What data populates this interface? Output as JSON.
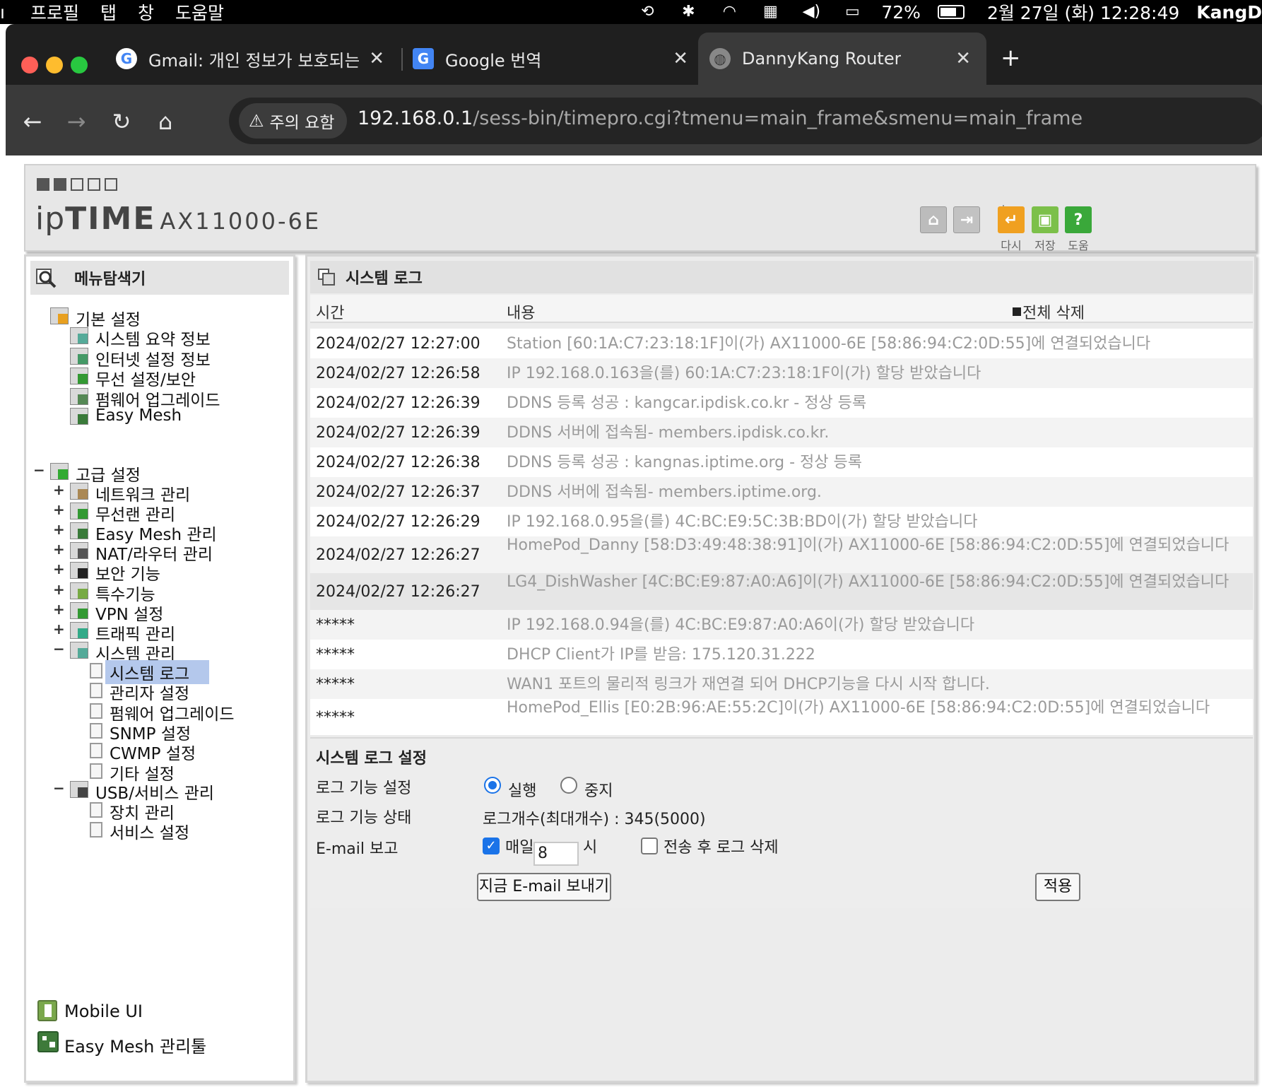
{
  "menubar": {
    "apple_partial": "ı",
    "items": [
      "프로필",
      "탭",
      "창",
      "도움말"
    ],
    "battery": "72%",
    "datetime": "2월 27일 (화)  12:28:49",
    "user": "KangD"
  },
  "browser": {
    "tabs": [
      {
        "title": "Gmail: 개인 정보가 보호되는 안전한",
        "favicon": "google-g"
      },
      {
        "title": "Google 번역",
        "favicon": "google-translate"
      },
      {
        "title": "DannyKang Router",
        "favicon": "globe",
        "active": true
      }
    ],
    "security_label": "주의 요함",
    "url_host": "192.168.0.1",
    "url_path": "/sess-bin/timepro.cgi?tmenu=main_frame&smenu=main_frame"
  },
  "header": {
    "brand_ip": "ip",
    "brand_time": "TIME",
    "model": "AX11000-6E",
    "buttons": [
      {
        "icon": "home-icon",
        "label": ""
      },
      {
        "icon": "logout-icon",
        "label": ""
      },
      {
        "icon": "restart-icon",
        "label": "다시",
        "color": "#f0a020"
      },
      {
        "icon": "save-icon",
        "label": "저장",
        "color": "#7cc04a"
      },
      {
        "icon": "help-icon",
        "label": "도움",
        "color": "#3aa83a"
      }
    ]
  },
  "sidebar": {
    "title": "메뉴탐색기",
    "basic": {
      "label": "기본 설정",
      "items": [
        "시스템 요약 정보",
        "인터넷 설정 정보",
        "무선 설정/보안",
        "펌웨어 업그레이드",
        "Easy Mesh"
      ]
    },
    "advanced": {
      "label": "고급 설정",
      "items": [
        "네트워크 관리",
        "무선랜 관리",
        "Easy Mesh 관리",
        "NAT/라우터 관리",
        "보안 기능",
        "특수기능",
        "VPN 설정",
        "트래픽 관리"
      ],
      "system": {
        "label": "시스템 관리",
        "items": [
          "시스템 로그",
          "관리자 설정",
          "펌웨어 업그레이드",
          "SNMP 설정",
          "CWMP 설정",
          "기타 설정"
        ]
      },
      "usb": {
        "label": "USB/서비스 관리",
        "items": [
          "장치 관리",
          "서비스 설정"
        ]
      }
    },
    "footer": [
      "Mobile UI",
      "Easy Mesh 관리툴"
    ]
  },
  "main": {
    "title": "시스템 로그",
    "col_time": "시간",
    "col_content": "내용",
    "delete_all": "전체 삭제",
    "logs": [
      {
        "time": "2024/02/27 12:27:00",
        "msg": "Station [60:1A:C7:23:18:1F]이(가) AX11000-6E [58:86:94:C2:0D:55]에 연결되었습니다"
      },
      {
        "time": "2024/02/27 12:26:58",
        "msg": "IP 192.168.0.163을(를) 60:1A:C7:23:18:1F이(가) 할당 받았습니다"
      },
      {
        "time": "2024/02/27 12:26:39",
        "msg": "DDNS 등록 성공 : kangcar.ipdisk.co.kr - 정상 등록"
      },
      {
        "time": "2024/02/27 12:26:39",
        "msg": "DDNS 서버에 접속됨- members.ipdisk.co.kr."
      },
      {
        "time": "2024/02/27 12:26:38",
        "msg": "DDNS 등록 성공 : kangnas.iptime.org - 정상 등록"
      },
      {
        "time": "2024/02/27 12:26:37",
        "msg": "DDNS 서버에 접속됨- members.iptime.org."
      },
      {
        "time": "2024/02/27 12:26:29",
        "msg": "IP 192.168.0.95을(를) 4C:BC:E9:5C:3B:BD이(가) 할당 받았습니다"
      },
      {
        "time": "2024/02/27 12:26:27",
        "msg": "HomePod_Danny [58:D3:49:48:38:91]이(가) AX11000-6E [58:86:94:C2:0D:55]에 연결되었습니다"
      },
      {
        "time": "2024/02/27 12:26:27",
        "msg": "LG4_DishWasher [4C:BC:E9:87:A0:A6]이(가) AX11000-6E [58:86:94:C2:0D:55]에 연결되었습니다"
      },
      {
        "time": "*****",
        "msg": "IP 192.168.0.94을(를) 4C:BC:E9:87:A0:A6이(가) 할당 받았습니다"
      },
      {
        "time": "*****",
        "msg": "DHCP Client가 IP를 받음: 175.120.31.222"
      },
      {
        "time": "*****",
        "msg": "WAN1 포트의 물리적 링크가 재연결 되어 DHCP기능을 다시 시작 합니다."
      },
      {
        "time": "*****",
        "msg": "HomePod_Ellis [E0:2B:96:AE:55:2C]이(가) AX11000-6E [58:86:94:C2:0D:55]에 연결되었습니다"
      }
    ],
    "settings": {
      "title": "시스템 로그 설정",
      "log_func_label": "로그 기능 설정",
      "run_label": "실행",
      "stop_label": "중지",
      "status_label": "로그 기능 상태",
      "status_value": "로그개수(최대개수) : 345(5000)",
      "email_label": "E-mail 보고",
      "daily_label": "매일",
      "hour_value": "8",
      "hour_unit": "시",
      "delete_after_label": "전송 후 로그 삭제",
      "send_now": "지금 E-mail 보내기",
      "apply": "적용"
    }
  }
}
